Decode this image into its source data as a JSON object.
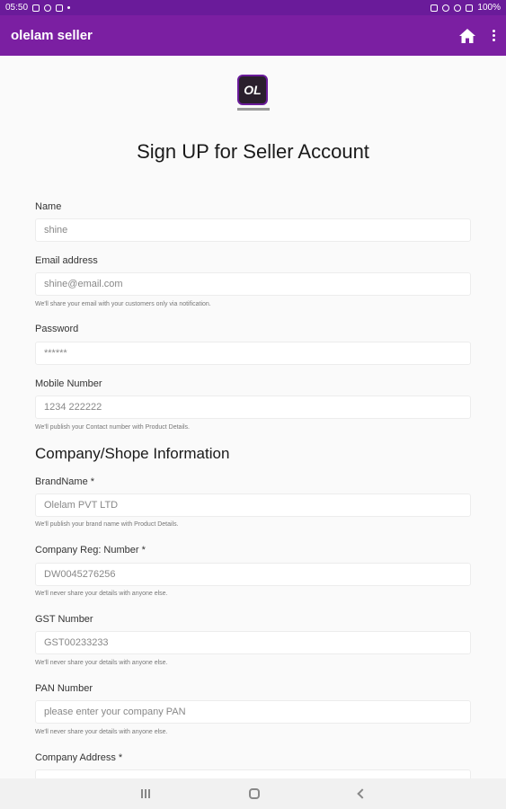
{
  "status_bar": {
    "time": "05:50",
    "battery": "100%"
  },
  "app_bar": {
    "title": "olelam seller"
  },
  "logo": {
    "text": "OL"
  },
  "form": {
    "title": "Sign UP for Seller Account",
    "name": {
      "label": "Name",
      "placeholder": "shine"
    },
    "email": {
      "label": "Email address",
      "placeholder": "shine@email.com",
      "help": "We'll share your email with your customers only via notification."
    },
    "password": {
      "label": "Password",
      "placeholder": "******"
    },
    "mobile": {
      "label": "Mobile Number",
      "placeholder": "1234 222222",
      "help": "We'll publish your Contact number with Product Details."
    },
    "company_section_title": "Company/Shope Information",
    "brand": {
      "label": "BrandName *",
      "placeholder": "Olelam PVT LTD",
      "help": "We'll publish your brand name with Product Details."
    },
    "company_reg": {
      "label": "Company Reg: Number *",
      "placeholder": "DW0045276256",
      "help": "We'll never share your details with anyone else."
    },
    "gst": {
      "label": "GST Number",
      "placeholder": "GST00233233",
      "help": "We'll never share your details with anyone else."
    },
    "pan": {
      "label": "PAN Number",
      "placeholder": "please enter your company PAN",
      "help": "We'll never share your details with anyone else."
    },
    "address": {
      "label": "Company Address *"
    }
  }
}
